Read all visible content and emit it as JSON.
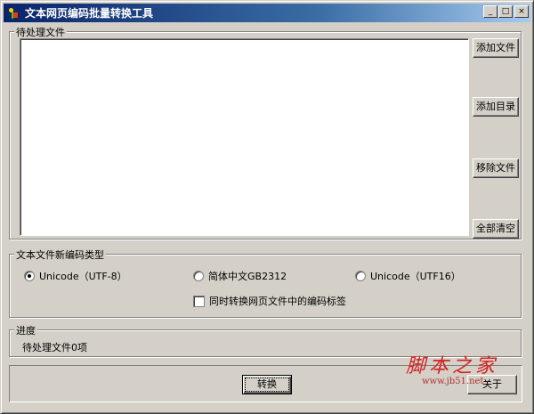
{
  "window": {
    "title": "文本网页编码批量转换工具",
    "icon": "app-icon",
    "controls": {
      "minimize": "_",
      "maximize": "□",
      "close": "×"
    }
  },
  "files_group": {
    "label": "待处理文件",
    "buttons": {
      "add_file": "添加文件",
      "add_dir": "添加目录",
      "remove_file": "移除文件",
      "clear_all": "全部清空"
    }
  },
  "encoding_group": {
    "label": "文本文件新编码类型",
    "options": [
      {
        "label": "Unicode（UTF-8）",
        "selected": true
      },
      {
        "label": "简体中文GB2312",
        "selected": false
      },
      {
        "label": "Unicode（UTF16）",
        "selected": false
      }
    ],
    "checkbox": {
      "label": "同时转换网页文件中的编码标签",
      "checked": false
    }
  },
  "progress_group": {
    "label": "进度",
    "status": "待处理文件0项"
  },
  "footer": {
    "convert": "转换",
    "about": "关于"
  },
  "watermark": {
    "main": "脚本之家",
    "url": "www.jb51.net"
  }
}
